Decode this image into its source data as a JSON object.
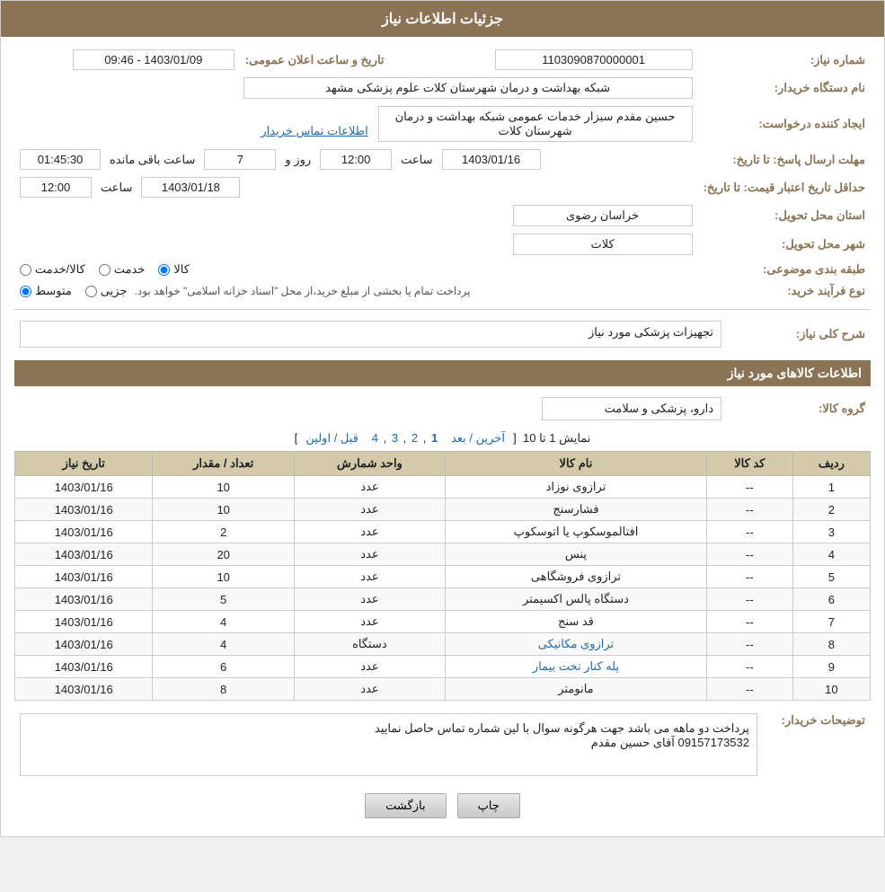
{
  "header": {
    "title": "جزئیات اطلاعات نیاز"
  },
  "fields": {
    "request_number_label": "شماره نیاز:",
    "request_number_value": "1103090870000001",
    "buyer_org_label": "نام دستگاه خریدار:",
    "buyer_org_value": "شبکه بهداشت و درمان شهرستان کلات   علوم پزشکی مشهد",
    "requester_label": "ایجاد کننده درخواست:",
    "requester_value": "حسین مقدم سبزار خدمات عمومی شبکه بهداشت و درمان شهرستان کلات",
    "requester_link": "اطلاعات تماس خریدار",
    "announce_date_label": "تاریخ و ساعت اعلان عمومی:",
    "announce_date_value": "1403/01/09 - 09:46",
    "response_deadline_label": "مهلت ارسال پاسخ: تا تاریخ:",
    "response_date_value": "1403/01/16",
    "response_time_label": "ساعت",
    "response_time_value": "12:00",
    "response_days_label": "روز و",
    "response_days_value": "7",
    "response_remaining_label": "ساعت باقی مانده",
    "response_remaining_value": "01:45:30",
    "price_deadline_label": "حداقل تاریخ اعتبار قیمت: تا تاریخ:",
    "price_date_value": "1403/01/18",
    "price_time_label": "ساعت",
    "price_time_value": "12:00",
    "province_label": "استان محل تحویل:",
    "province_value": "خراسان رضوی",
    "city_label": "شهر محل تحویل:",
    "city_value": "کلات",
    "category_label": "طبقه بندی موضوعی:",
    "category_options": [
      "کالا",
      "خدمت",
      "کالا/خدمت"
    ],
    "category_selected": "کالا",
    "process_label": "نوع فرآیند خرید:",
    "process_options": [
      "جزیی",
      "متوسط"
    ],
    "process_selected": "متوسط",
    "process_description": "پرداخت تمام یا بخشی از مبلغ خرید،از محل \"اسناد خزانه اسلامی\" خواهد بود.",
    "needs_desc_label": "شرح کلی نیاز:",
    "needs_desc_value": "تجهیزات پزشکی مورد نیاز",
    "goods_info_title": "اطلاعات کالاهای مورد نیاز",
    "goods_group_label": "گروه کالا:",
    "goods_group_value": "دارو، پزشکی و سلامت",
    "pagination": {
      "text": "نمایش 1 تا 10",
      "links": [
        "آخرین / بعد",
        "1",
        "2",
        "3",
        "4",
        "قبل / اولین"
      ]
    },
    "table_headers": [
      "ردیف",
      "کد کالا",
      "نام کالا",
      "واحد شمارش",
      "تعداد / مقدار",
      "تاریخ نیاز"
    ],
    "table_rows": [
      {
        "row": "1",
        "code": "--",
        "name": "ترازوی نوزاد",
        "unit": "عدد",
        "qty": "10",
        "date": "1403/01/16"
      },
      {
        "row": "2",
        "code": "--",
        "name": "فشارسنج",
        "unit": "عدد",
        "qty": "10",
        "date": "1403/01/16"
      },
      {
        "row": "3",
        "code": "--",
        "name": "افتالموسکوپ یا اتوسکوپ",
        "unit": "عدد",
        "qty": "2",
        "date": "1403/01/16"
      },
      {
        "row": "4",
        "code": "--",
        "name": "پنس",
        "unit": "عدد",
        "qty": "20",
        "date": "1403/01/16"
      },
      {
        "row": "5",
        "code": "--",
        "name": "ترازوی فروشگاهی",
        "unit": "عدد",
        "qty": "10",
        "date": "1403/01/16"
      },
      {
        "row": "6",
        "code": "--",
        "name": "دستگاه پالس اکسیمتر",
        "unit": "عدد",
        "qty": "5",
        "date": "1403/01/16"
      },
      {
        "row": "7",
        "code": "--",
        "name": "قد سنج",
        "unit": "عدد",
        "qty": "4",
        "date": "1403/01/16"
      },
      {
        "row": "8",
        "code": "--",
        "name": "ترازوی مکانیکی",
        "unit": "دستگاه",
        "qty": "4",
        "date": "1403/01/16"
      },
      {
        "row": "9",
        "code": "--",
        "name": "پله کنار تخت بیمار",
        "unit": "عدد",
        "qty": "6",
        "date": "1403/01/16"
      },
      {
        "row": "10",
        "code": "--",
        "name": "مانومتر",
        "unit": "عدد",
        "qty": "8",
        "date": "1403/01/16"
      }
    ],
    "comments_label": "توضیحات خریدار:",
    "comments_value": "پرداخت دو ماهه می باشد جهت هرگونه سوال با لین شماره تماس حاصل نمایید\n09157173532 آقای حسین مقدم",
    "btn_print": "چاپ",
    "btn_back": "بازگشت"
  }
}
